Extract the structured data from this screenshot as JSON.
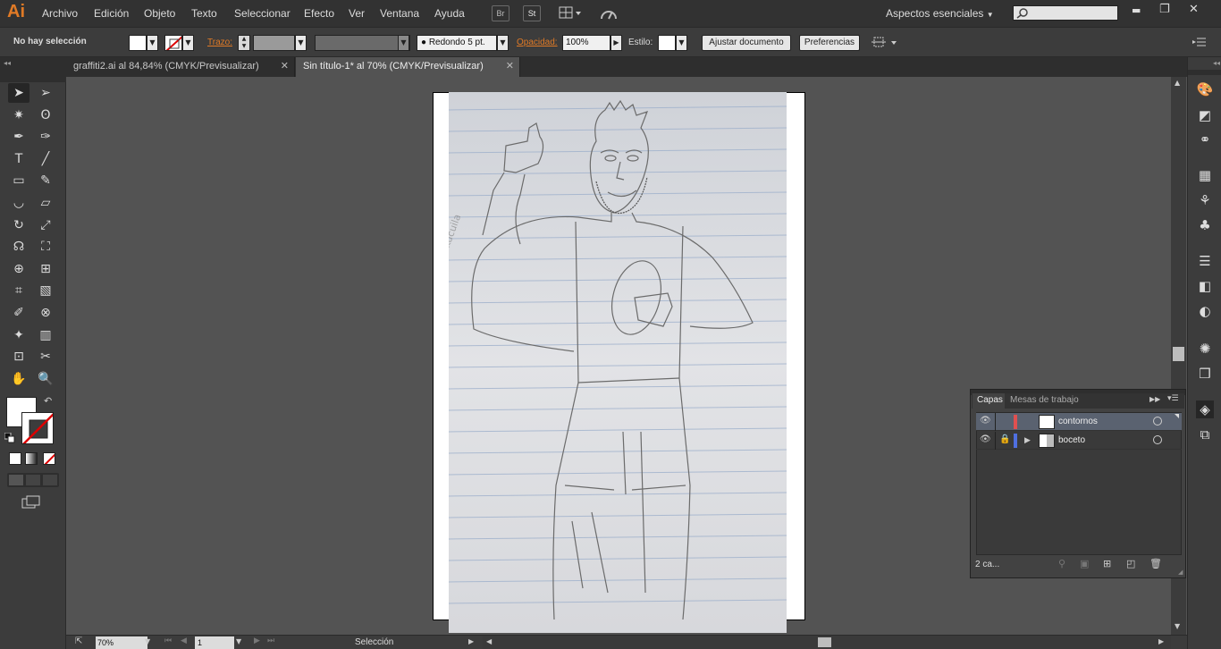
{
  "app": {
    "logo": "Ai"
  },
  "menu": [
    "Archivo",
    "Edición",
    "Objeto",
    "Texto",
    "Seleccionar",
    "Efecto",
    "Ver",
    "Ventana",
    "Ayuda"
  ],
  "menu_icons": {
    "bridge": "Br",
    "stock": "St"
  },
  "workspace": {
    "label": "Aspectos esenciales",
    "search_placeholder": ""
  },
  "window_controls": {
    "minimize": "▬",
    "restore": "❐",
    "close": "✕"
  },
  "control": {
    "selection": "No hay selección",
    "trazo_label": "Trazo:",
    "brush": "Redondo 5 pt.",
    "opacity_label": "Opacidad:",
    "opacity_value": "100%",
    "style_label": "Estilo:",
    "fit_button": "Ajustar documento",
    "prefs_button": "Preferencias"
  },
  "tabs": [
    {
      "label": "graffiti2.ai al 84,84% (CMYK/Previsualizar)",
      "close": "✕"
    },
    {
      "label": "Sin título-1* al 70% (CMYK/Previsualizar)",
      "close": "✕"
    }
  ],
  "status": {
    "zoom": "70%",
    "artboard": "1",
    "tool": "Selección"
  },
  "layers_panel": {
    "tabs": [
      "Capas",
      "Mesas de trabajo"
    ],
    "count": "2 ca...",
    "layers": [
      {
        "name": "contornos",
        "color": "#e05050",
        "locked": false
      },
      {
        "name": "boceto",
        "color": "#4f6fe0",
        "locked": true
      }
    ]
  },
  "sketch": {
    "watermark": "©elHakucuila"
  },
  "colors": {
    "accent": "#e07a26",
    "panel": "#3c3c3c",
    "canvas": "#535353"
  },
  "icons": [
    "selection-tool-icon",
    "direct-selection-tool-icon",
    "magic-wand-tool-icon",
    "lasso-tool-icon",
    "pen-tool-icon",
    "curvature-tool-icon",
    "type-tool-icon",
    "line-tool-icon",
    "rectangle-tool-icon",
    "paintbrush-tool-icon",
    "shaper-tool-icon",
    "eraser-tool-icon",
    "rotate-tool-icon",
    "scale-tool-icon",
    "warp-tool-icon",
    "free-transform-tool-icon",
    "shape-builder-tool-icon",
    "perspective-grid-tool-icon",
    "mesh-tool-icon",
    "gradient-tool-icon",
    "eyedropper-tool-icon",
    "blend-tool-icon",
    "symbol-sprayer-tool-icon",
    "column-graph-tool-icon",
    "artboard-tool-icon",
    "slice-tool-icon",
    "hand-tool-icon",
    "zoom-tool-icon"
  ]
}
